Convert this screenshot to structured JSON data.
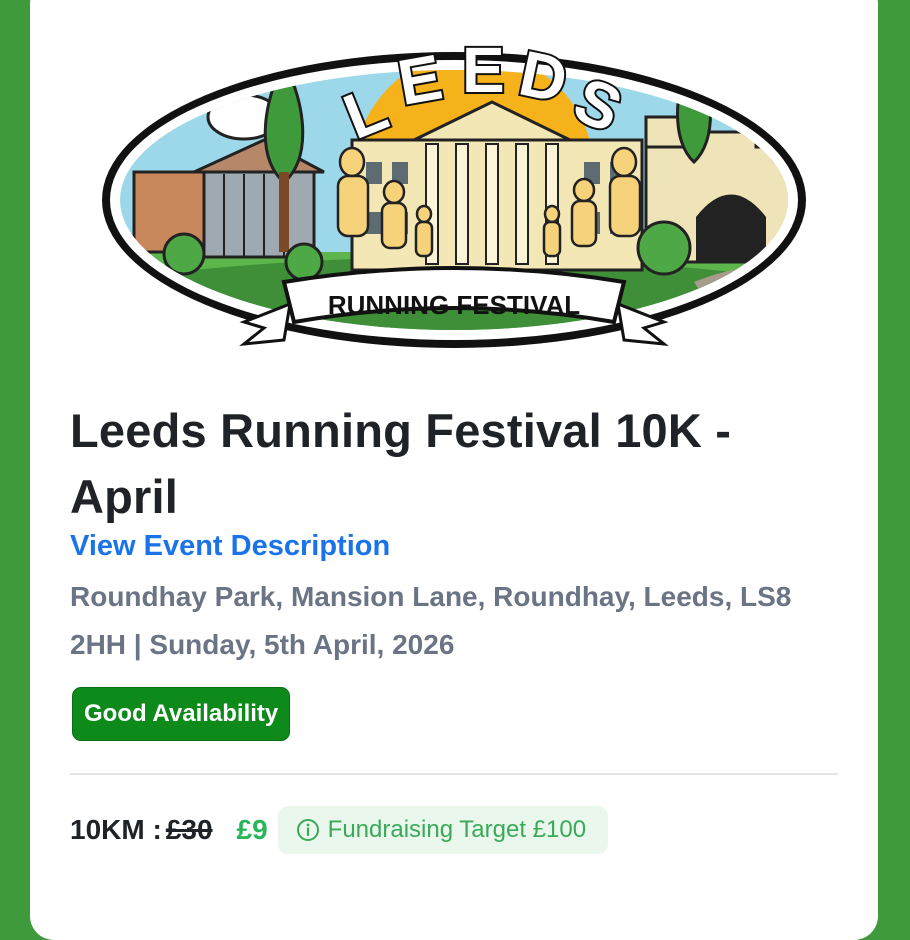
{
  "event": {
    "logo_title": "LEEDS",
    "logo_banner": "RUNNING FESTIVAL",
    "title": "Leeds Running Festival 10K - April",
    "description_link": "View Event Description",
    "location": "Roundhay Park, Mansion Lane, Roundhay, Leeds, LS8 2HH | Sunday, 5th April, 2026",
    "availability": "Good Availability",
    "pricing": {
      "distance": "10KM :",
      "old_price": "£30",
      "new_price": "£9",
      "fundraising": "Fundraising Target £100"
    }
  },
  "colors": {
    "background": "#3f9a3c",
    "link": "#1a73e8",
    "badge": "#0d8a1a",
    "price": "#2bb55a",
    "fund_bg": "#e9f7ec"
  },
  "icons": [
    "info-icon"
  ]
}
